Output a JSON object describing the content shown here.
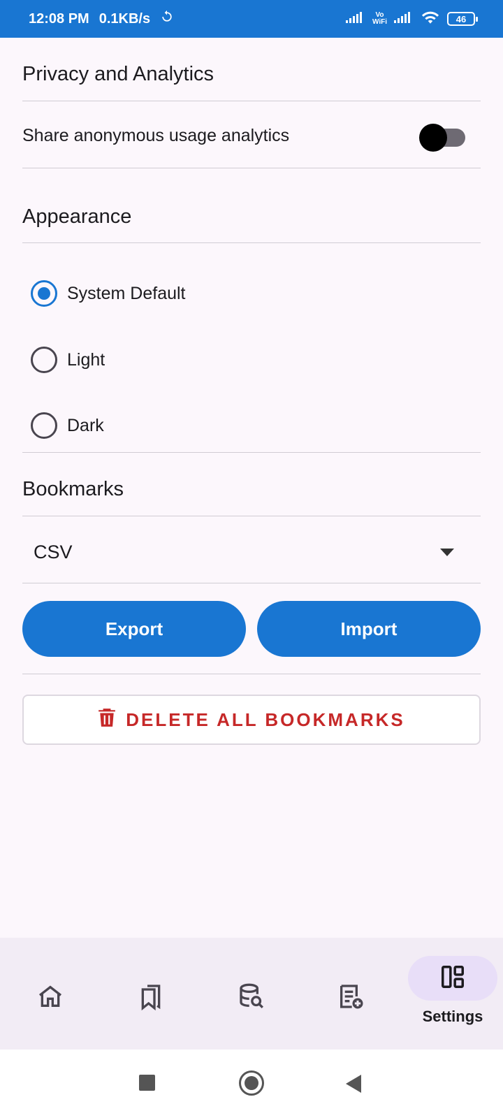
{
  "status_bar": {
    "time": "12:08 PM",
    "speed": "0.1KB/s",
    "vowifi_top": "Vo",
    "vowifi_bottom": "WiFi",
    "battery": "46"
  },
  "privacy": {
    "title": "Privacy and Analytics",
    "analytics_label": "Share anonymous usage analytics",
    "analytics_enabled": false
  },
  "appearance": {
    "title": "Appearance",
    "options": [
      {
        "label": "System Default",
        "selected": true
      },
      {
        "label": "Light",
        "selected": false
      },
      {
        "label": "Dark",
        "selected": false
      }
    ]
  },
  "bookmarks": {
    "title": "Bookmarks",
    "format_selected": "CSV",
    "export_label": "Export",
    "import_label": "Import",
    "delete_label": "DELETE ALL BOOKMARKS"
  },
  "bottom_nav": {
    "items": [
      {
        "icon": "home-icon"
      },
      {
        "icon": "bookmarks-icon"
      },
      {
        "icon": "database-search-icon"
      },
      {
        "icon": "add-note-icon"
      },
      {
        "icon": "settings-dashboard-icon",
        "label": "Settings",
        "active": true
      }
    ]
  },
  "colors": {
    "primary": "#1976D2",
    "danger": "#C62828",
    "background": "#FCF7FC",
    "nav_background": "#F2ECF5",
    "active_pill": "#E8DEF8"
  }
}
